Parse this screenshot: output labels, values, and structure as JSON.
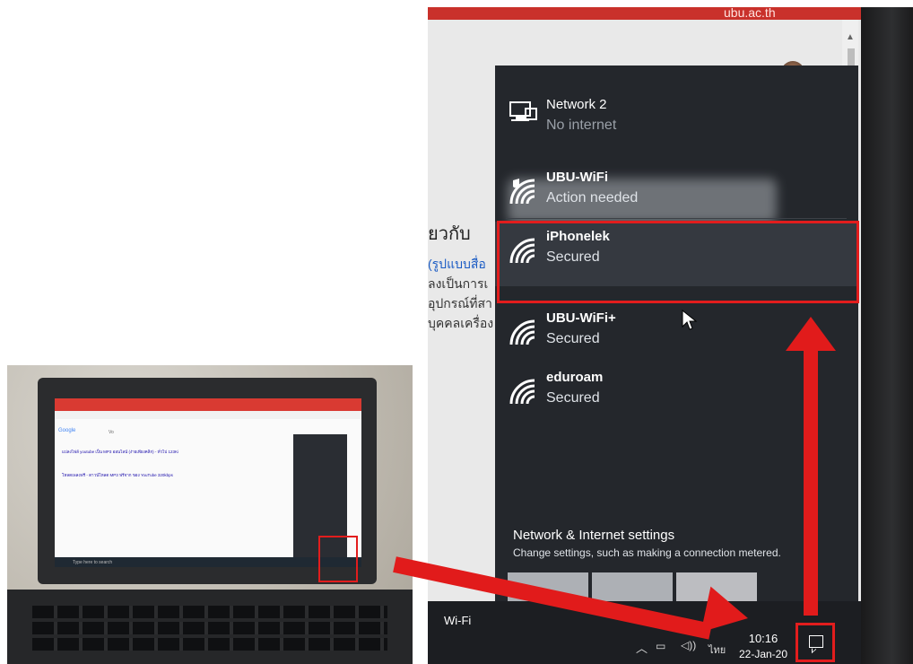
{
  "laptop_screen": {
    "google_label": "Google",
    "search_text": "Vo",
    "heading_1": "แปลงไฟล์ youtube เป็น MP3 ออนไลน์ (ง่ายเพียงคลิก) - ทั่วไป 123Ki",
    "heading_2": "โหลดเพลงฟรี - ดาวน์โหลด MP3 ฟรีจาก ของ YouTube 320kbps",
    "taskbar_search": "Type here to search"
  },
  "browser": {
    "url_fragment": "ubu.ac.th",
    "heading": "ี่ยวกับ",
    "line_1": "(รูปแบบสื่อ",
    "line_2": "ลงเป็นการเ",
    "line_3": "อุปกรณ์ที่สา",
    "line_4": "บุคคลเครื่อง"
  },
  "wifi_panel": {
    "network2": {
      "name": "Network 2",
      "status": "No internet"
    },
    "networks": [
      {
        "name": "UBU-WiFi",
        "status": "Action needed",
        "icon": "wifi-secured-shield-icon"
      },
      {
        "name": "iPhonelek",
        "status": "Secured",
        "icon": "wifi-secured-icon"
      },
      {
        "name": "UBU-WiFi+",
        "status": "Secured",
        "icon": "wifi-secured-icon"
      },
      {
        "name": "eduroam",
        "status": "Secured",
        "icon": "wifi-secured-icon"
      }
    ],
    "settings_title": "Network & Internet settings",
    "settings_desc": "Change settings, such as making a connection metered.",
    "tile_wifi_label": "Wi-Fi"
  },
  "taskbar": {
    "language": "ไทย",
    "time": "10:16",
    "date": "22-Jan-20"
  },
  "colors": {
    "highlight": "#e21d1d",
    "flyout_bg": "#24272c",
    "selected_item_bg": "#353940"
  }
}
